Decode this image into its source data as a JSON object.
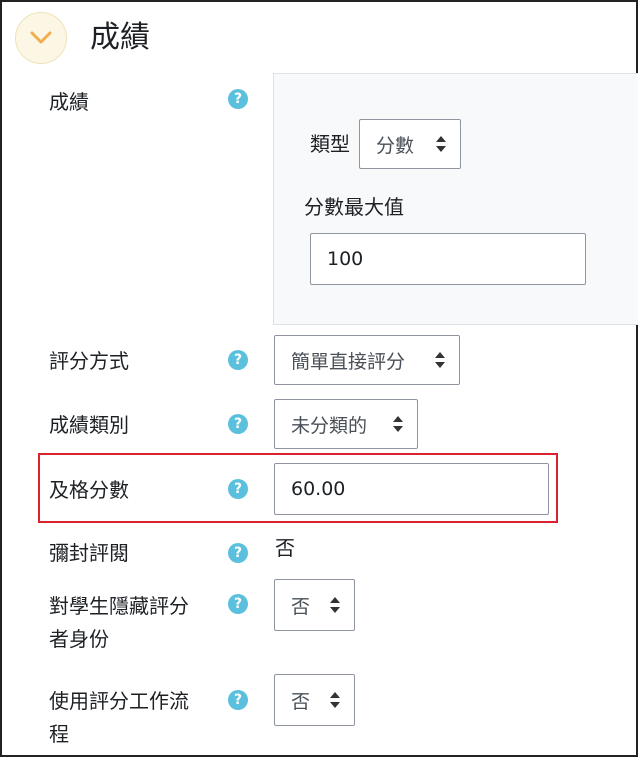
{
  "section": {
    "title": "成績",
    "toggle_icon": "chevron-down-icon",
    "toggle_color": "#f0ad4e"
  },
  "grade": {
    "label": "成績",
    "type_label": "類型",
    "type_value": "分數",
    "max_label": "分數最大值",
    "max_value": "100"
  },
  "grading_method": {
    "label": "評分方式",
    "value": "簡單直接評分"
  },
  "grade_category": {
    "label": "成績類別",
    "value": "未分類的"
  },
  "pass_grade": {
    "label": "及格分數",
    "value": "60.00",
    "highlight_color": "#d9232e"
  },
  "blind_marking": {
    "label": "彌封評閱",
    "value": "否"
  },
  "hide_identity": {
    "label_line1": "對學生隱藏評分",
    "label_line2": "者身份",
    "value": "否"
  },
  "marking_workflow": {
    "label_line1": "使用評分工作流",
    "label_line2": "程",
    "value": "否"
  },
  "help_icon": "question-circle-icon",
  "help_symbol": "?",
  "help_color": "#5bc0de"
}
